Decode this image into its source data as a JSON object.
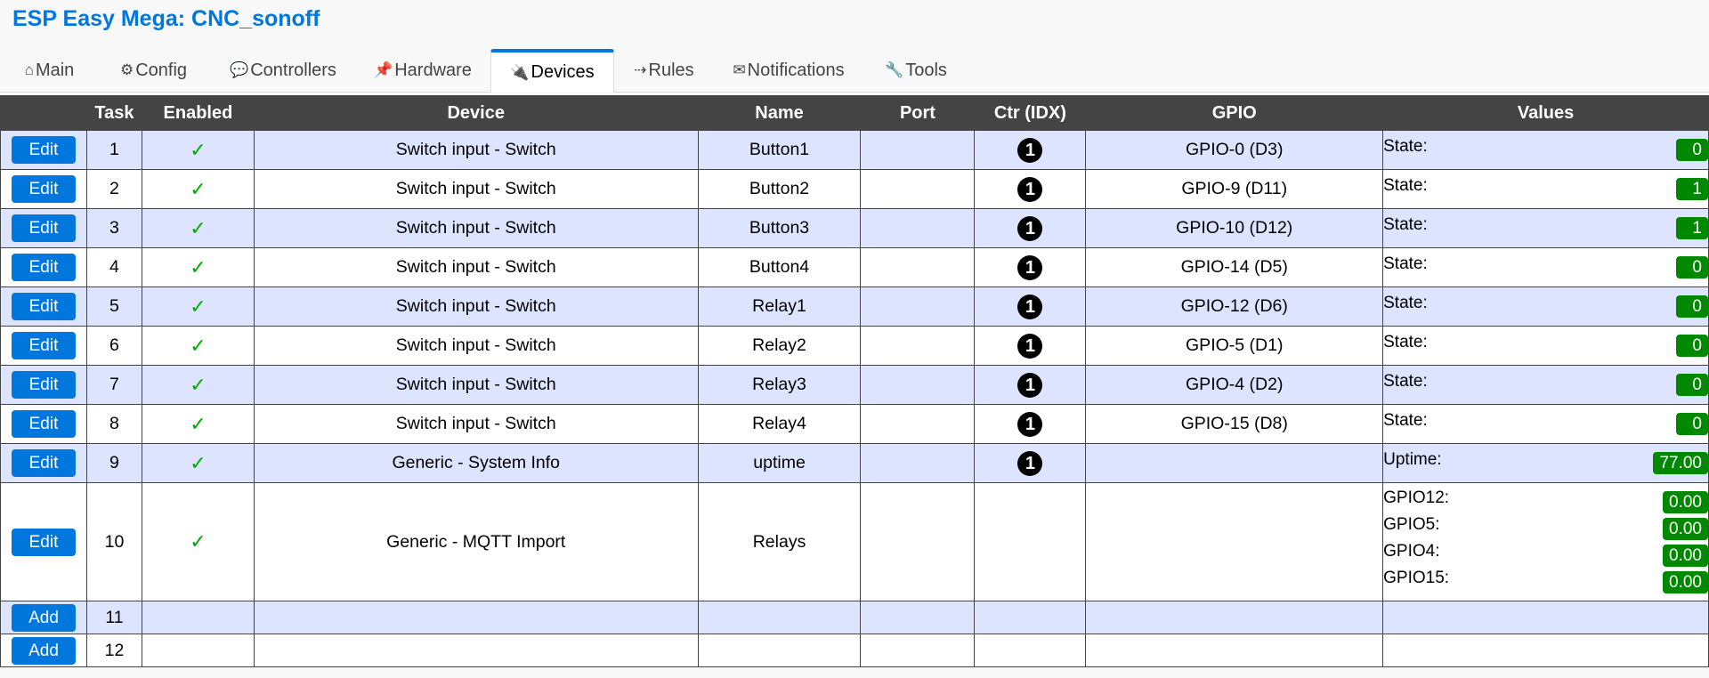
{
  "app": {
    "title": "ESP Easy Mega: CNC_sonoff"
  },
  "tabs": [
    {
      "icon": "⌂",
      "label": "Main"
    },
    {
      "icon": "⚙",
      "label": "Config"
    },
    {
      "icon": "💬",
      "label": "Controllers"
    },
    {
      "icon": "📌",
      "label": "Hardware"
    },
    {
      "icon": "🔌",
      "label": "Devices"
    },
    {
      "icon": "⇢",
      "label": "Rules"
    },
    {
      "icon": "✉",
      "label": "Notifications"
    },
    {
      "icon": "🔧",
      "label": "Tools"
    }
  ],
  "active_tab": "Devices",
  "table": {
    "headers": [
      "",
      "Task",
      "Enabled",
      "Device",
      "Name",
      "Port",
      "Ctr (IDX)",
      "GPIO",
      "Values"
    ],
    "rows": [
      {
        "button": "Edit",
        "task": "1",
        "enabled": "✓",
        "device": "Switch input - Switch",
        "name": "Button1",
        "port": "",
        "ctr": "1",
        "gpio": "GPIO-0 (D3)",
        "values": [
          {
            "label": "State:",
            "value": "0"
          }
        ]
      },
      {
        "button": "Edit",
        "task": "2",
        "enabled": "✓",
        "device": "Switch input - Switch",
        "name": "Button2",
        "port": "",
        "ctr": "1",
        "gpio": "GPIO-9 (D11)",
        "values": [
          {
            "label": "State:",
            "value": "1"
          }
        ]
      },
      {
        "button": "Edit",
        "task": "3",
        "enabled": "✓",
        "device": "Switch input - Switch",
        "name": "Button3",
        "port": "",
        "ctr": "1",
        "gpio": "GPIO-10 (D12)",
        "values": [
          {
            "label": "State:",
            "value": "1"
          }
        ]
      },
      {
        "button": "Edit",
        "task": "4",
        "enabled": "✓",
        "device": "Switch input - Switch",
        "name": "Button4",
        "port": "",
        "ctr": "1",
        "gpio": "GPIO-14 (D5)",
        "values": [
          {
            "label": "State:",
            "value": "0"
          }
        ]
      },
      {
        "button": "Edit",
        "task": "5",
        "enabled": "✓",
        "device": "Switch input - Switch",
        "name": "Relay1",
        "port": "",
        "ctr": "1",
        "gpio": "GPIO-12 (D6)",
        "values": [
          {
            "label": "State:",
            "value": "0"
          }
        ]
      },
      {
        "button": "Edit",
        "task": "6",
        "enabled": "✓",
        "device": "Switch input - Switch",
        "name": "Relay2",
        "port": "",
        "ctr": "1",
        "gpio": "GPIO-5 (D1)",
        "values": [
          {
            "label": "State:",
            "value": "0"
          }
        ]
      },
      {
        "button": "Edit",
        "task": "7",
        "enabled": "✓",
        "device": "Switch input - Switch",
        "name": "Relay3",
        "port": "",
        "ctr": "1",
        "gpio": "GPIO-4 (D2)",
        "values": [
          {
            "label": "State:",
            "value": "0"
          }
        ]
      },
      {
        "button": "Edit",
        "task": "8",
        "enabled": "✓",
        "device": "Switch input - Switch",
        "name": "Relay4",
        "port": "",
        "ctr": "1",
        "gpio": "GPIO-15 (D8)",
        "values": [
          {
            "label": "State:",
            "value": "0"
          }
        ]
      },
      {
        "button": "Edit",
        "task": "9",
        "enabled": "✓",
        "device": "Generic - System Info",
        "name": "uptime",
        "port": "",
        "ctr": "1",
        "gpio": "",
        "values": [
          {
            "label": "Uptime:",
            "value": "77.00"
          }
        ]
      },
      {
        "button": "Edit",
        "task": "10",
        "enabled": "✓",
        "device": "Generic - MQTT Import",
        "name": "Relays",
        "port": "",
        "ctr": "",
        "gpio": "",
        "values": [
          {
            "label": "GPIO12:",
            "value": "0.00"
          },
          {
            "label": "GPIO5:",
            "value": "0.00"
          },
          {
            "label": "GPIO4:",
            "value": "0.00"
          },
          {
            "label": "GPIO15:",
            "value": "0.00"
          }
        ]
      },
      {
        "button": "Add",
        "task": "11",
        "enabled": "",
        "device": "",
        "name": "",
        "port": "",
        "ctr": "",
        "gpio": "",
        "values": []
      },
      {
        "button": "Add",
        "task": "12",
        "enabled": "",
        "device": "",
        "name": "",
        "port": "",
        "ctr": "",
        "gpio": "",
        "values": []
      }
    ]
  },
  "colors": {
    "accent": "#0077dd",
    "header_bg": "#444444",
    "row_alt": "#dde4ff",
    "badge": "#008800",
    "check": "#00aa00"
  }
}
